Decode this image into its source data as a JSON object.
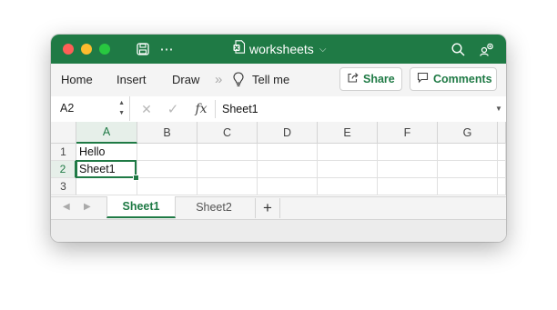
{
  "window": {
    "title": "worksheets",
    "title_chevron": "⌵",
    "accent_color": "#1f7a45",
    "icons": [
      "save-icon",
      "more-icon",
      "excel-file-icon",
      "search-icon",
      "share-people-icon"
    ],
    "more_glyph": "⋯"
  },
  "ribbon": {
    "tabs": [
      "Home",
      "Insert",
      "Draw"
    ],
    "overflow_glyph": "»",
    "tell_me": "Tell me",
    "share_label": "Share",
    "comments_label": "Comments"
  },
  "formula_bar": {
    "name_box": "A2",
    "spin_up": "▲",
    "spin_down": "▼",
    "cancel_glyph": "✕",
    "enter_glyph": "✓",
    "fx_label": "fx",
    "value": "Sheet1",
    "dropdown_glyph": "▼"
  },
  "grid": {
    "columns": [
      "A",
      "B",
      "C",
      "D",
      "E",
      "F",
      "G",
      ""
    ],
    "rows": [
      "1",
      "2",
      "3"
    ],
    "cells": [
      [
        "Hello",
        "",
        "",
        "",
        "",
        "",
        "",
        ""
      ],
      [
        "Sheet1",
        "",
        "",
        "",
        "",
        "",
        "",
        ""
      ],
      [
        "",
        "",
        "",
        "",
        "",
        "",
        "",
        ""
      ]
    ],
    "active_cell": "A2",
    "active_column": "A",
    "active_row": "2"
  },
  "sheets": {
    "nav_prev": "◀",
    "nav_next": "▶",
    "tabs": [
      "Sheet1",
      "Sheet2"
    ],
    "active": "Sheet1",
    "add_glyph": "+"
  }
}
